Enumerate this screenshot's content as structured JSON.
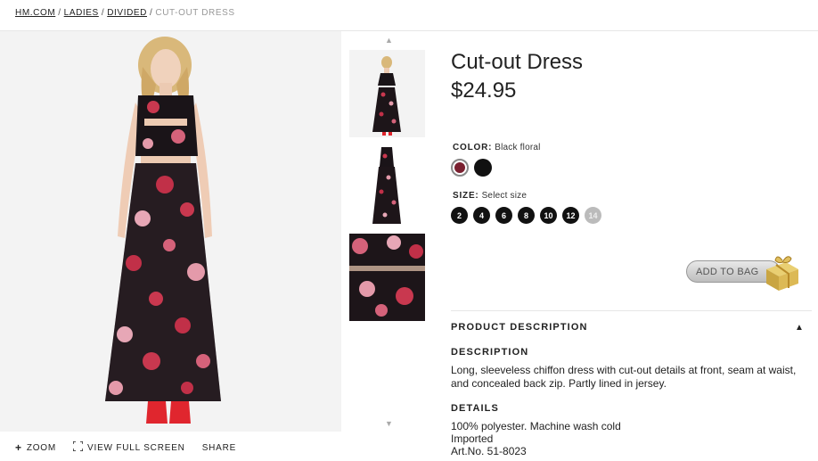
{
  "breadcrumb": {
    "items": [
      "HM.COM",
      "LADIES",
      "DIVIDED"
    ],
    "current": "CUT-OUT DRESS"
  },
  "image_tools": {
    "zoom": "ZOOM",
    "fullscreen": "VIEW FULL SCREEN",
    "share": "SHARE"
  },
  "product": {
    "title": "Cut-out Dress",
    "price": "$24.95"
  },
  "color": {
    "label": "COLOR:",
    "value": "Black floral",
    "swatches": [
      "#7a2030",
      "#111111"
    ]
  },
  "size": {
    "label": "SIZE:",
    "value": "Select size",
    "options": [
      "2",
      "4",
      "6",
      "8",
      "10",
      "12",
      "14"
    ]
  },
  "add_to_bag": "ADD TO BAG",
  "description": {
    "section_title": "PRODUCT DESCRIPTION",
    "desc_heading": "DESCRIPTION",
    "desc_text": "Long, sleeveless chiffon dress with cut-out details at front, seam at waist, and concealed back zip. Partly lined in jersey.",
    "details_heading": "DETAILS",
    "details": [
      "100% polyester. Machine wash cold",
      "Imported",
      "Art.No. 51-8023"
    ]
  },
  "colors": {
    "text": "#222222",
    "muted": "#999999",
    "image_bg": "#f3f3f3"
  }
}
